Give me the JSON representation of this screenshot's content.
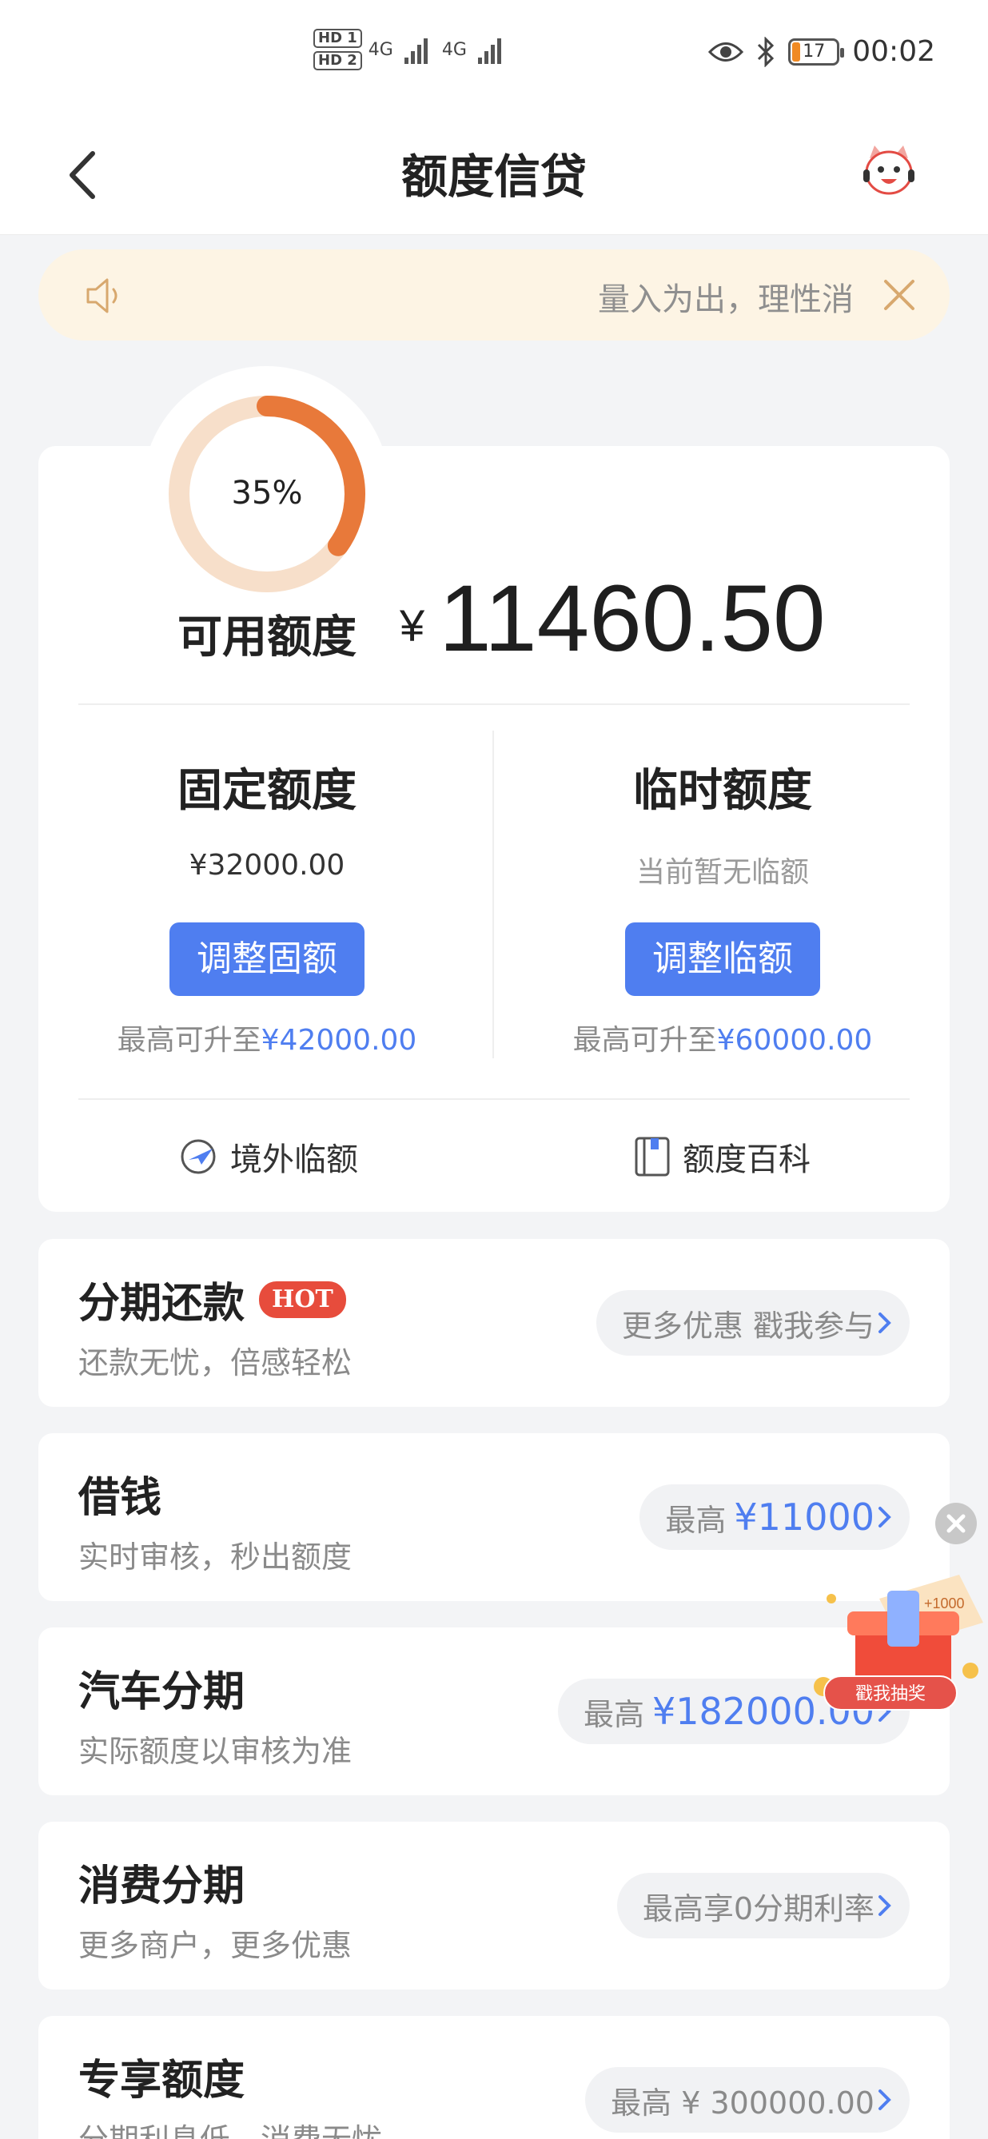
{
  "status_bar": {
    "hd1": "HD 1",
    "hd2": "HD 2",
    "net1": "4G",
    "net2": "4G",
    "battery": "17",
    "time": "00:02",
    "icons": [
      "eye-icon",
      "bluetooth-icon",
      "battery-icon"
    ]
  },
  "header": {
    "title": "额度信贷",
    "back_icon": "back-chevron-icon",
    "service_icon": "customer-service-mascot-icon"
  },
  "notice": {
    "text": "量入为出，理性消",
    "icon": "speaker-icon",
    "close_icon": "close-icon"
  },
  "credit": {
    "usage_percent_label": "35%",
    "usage_fraction": 0.35,
    "available_label": "可用额度",
    "currency": "¥",
    "available_amount": "11460.50",
    "fixed": {
      "title": "固定额度",
      "value": "¥32000.00",
      "button": "调整固额",
      "max_prefix": "最高可升至",
      "max_amount": "¥42000.00"
    },
    "temporary": {
      "title": "临时额度",
      "value": "当前暂无临额",
      "button": "调整临额",
      "max_prefix": "最高可升至",
      "max_amount": "¥60000.00"
    },
    "links": [
      {
        "label": "境外临额",
        "icon": "globe-plane-icon"
      },
      {
        "label": "额度百科",
        "icon": "book-icon"
      }
    ]
  },
  "products": [
    {
      "title": "分期还款",
      "badge": "HOT",
      "subtitle": "还款无忧，倍感轻松",
      "pill_prefix": "更多优惠 戳我参与",
      "pill_amount": ""
    },
    {
      "title": "借钱",
      "badge": "",
      "subtitle": "实时审核，秒出额度",
      "pill_prefix": "最高",
      "pill_amount": "¥11000"
    },
    {
      "title": "汽车分期",
      "badge": "",
      "subtitle": "实际额度以审核为准",
      "pill_prefix": "最高",
      "pill_amount": "¥182000.00"
    },
    {
      "title": "消费分期",
      "badge": "",
      "subtitle": "更多商户，更多优惠",
      "pill_prefix": "最高享0分期利率",
      "pill_amount": ""
    },
    {
      "title": "专享额度",
      "badge": "",
      "subtitle": "分期利息低，消费无忧",
      "pill_prefix": "最高 ¥ 300000.00",
      "pill_amount": ""
    }
  ],
  "float_promo": {
    "button": "戳我抽奖",
    "badge": "+1000",
    "close_icon": "close-icon",
    "image_icon": "gift-box-icon"
  },
  "colors": {
    "accent_blue": "#4f7ef0",
    "ring_orange": "#e8793a",
    "ring_track": "#f7dfca",
    "hot_red": "#e74c3c",
    "notice_bg": "#fdf4e4"
  }
}
